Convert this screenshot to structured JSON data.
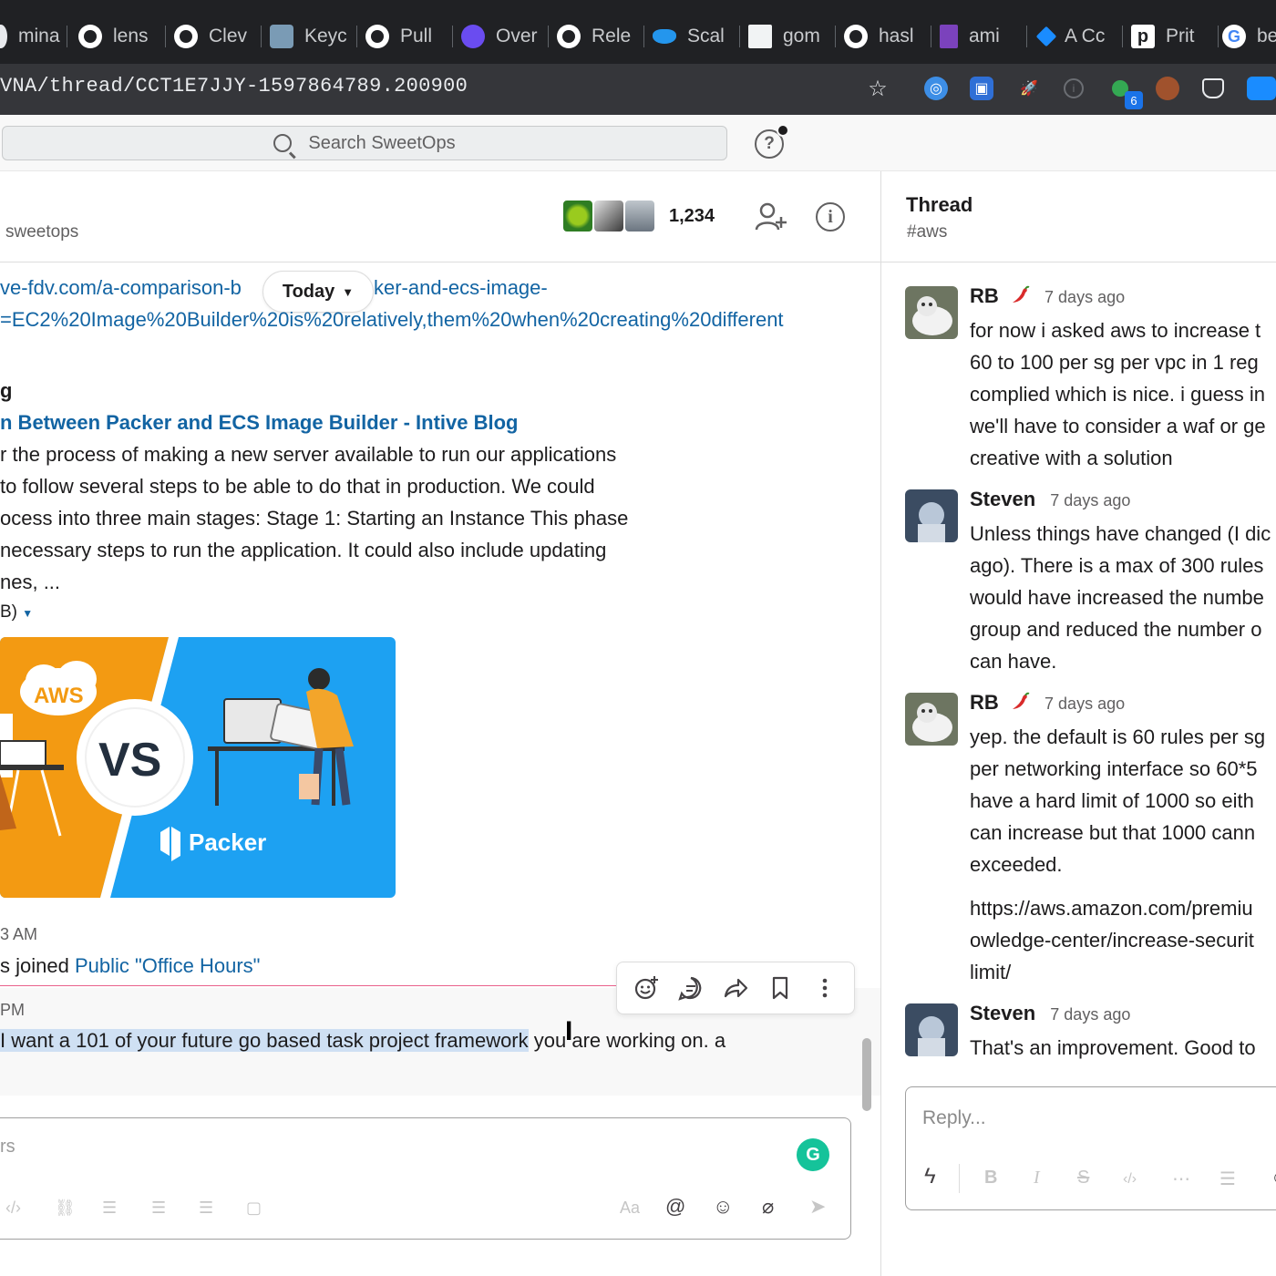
{
  "browser": {
    "tabs": [
      {
        "label": "mina",
        "icon": "generic-tab-icon"
      },
      {
        "label": "lens",
        "icon": "github-icon"
      },
      {
        "label": "Clev",
        "icon": "github-icon"
      },
      {
        "label": "Keyc",
        "icon": "keycloak-icon"
      },
      {
        "label": "Pull",
        "icon": "github-icon"
      },
      {
        "label": "Over",
        "icon": "overview-icon"
      },
      {
        "label": "Rele",
        "icon": "github-icon"
      },
      {
        "label": "Scal",
        "icon": "docker-icon"
      },
      {
        "label": "gom",
        "icon": "document-icon"
      },
      {
        "label": "hasl",
        "icon": "github-icon"
      },
      {
        "label": "ami",
        "icon": "terraform-icon"
      },
      {
        "label": "A Cc",
        "icon": "diamond-icon"
      },
      {
        "label": "Prit",
        "icon": "pritunl-icon"
      },
      {
        "label": "be",
        "icon": "google-icon"
      }
    ],
    "url": "VNA/thread/CCT1E7JJY-1597864789.200900",
    "extension_badge": "6"
  },
  "slack": {
    "search_placeholder": "Search SweetOps",
    "help_label": "?",
    "channel": {
      "workspace": "sweetops",
      "member_count": "1,234"
    },
    "messages": {
      "today_label": "Today",
      "link_line1_a": "ve-fdv.com/a-comparison-b",
      "link_line1_b": "ker-and-ecs-image-",
      "link_line2": "=EC2%20Image%20Builder%20is%20relatively,them%20when%20creating%20different",
      "unfurl_source": "g",
      "unfurl_title": "n Between Packer and ECS Image Builder - Intive Blog",
      "unfurl_desc": [
        "r the process of making a new server available to run our applications",
        "to follow several steps to be able to do that in production. We could",
        "ocess into three main stages:  Stage 1: Starting an Instance  This phase",
        " necessary steps to run the application. It could also include updating",
        "nes, ..."
      ],
      "unfurl_size": "B)",
      "image_text": {
        "aws": "AWS",
        "vs": "VS",
        "packer": "Packer"
      },
      "joined_time": "3 AM",
      "joined_prefix": "s joined ",
      "joined_channel": "Public \"Office Hours\"",
      "last_time": "PM",
      "last_selected": "I want a 101 of your future go based task project framework",
      "last_rest": " you are working on. a"
    },
    "composer": {
      "placeholder": "rs",
      "grammarly": "G",
      "aa": "Aa",
      "at": "@"
    }
  },
  "thread": {
    "title": "Thread",
    "channel": "#aws",
    "messages": [
      {
        "author": "RB",
        "emoji": "chili-pepper-icon",
        "time": "7 days ago",
        "lines": [
          "for now i asked aws to increase t",
          "60 to 100 per sg per vpc in 1 reg",
          "complied which is nice. i guess in",
          "we'll have to consider a waf or ge",
          "creative with a solution"
        ]
      },
      {
        "author": "Steven",
        "time": "7 days ago",
        "lines": [
          "Unless things have changed (I dic",
          "ago). There is a max of 300 rules",
          "would have increased the numbe",
          "group and reduced the number o",
          "can have."
        ]
      },
      {
        "author": "RB",
        "emoji": "chili-pepper-icon",
        "time": "7 days ago",
        "lines": [
          "yep. the default is 60 rules per sg",
          "per networking interface so 60*5",
          "have a hard limit of 1000 so eith",
          "can increase but that 1000 cann",
          "exceeded."
        ],
        "link_lines": [
          "https://aws.amazon.com/premiu",
          "owledge-center/increase-securit",
          "limit/"
        ]
      },
      {
        "author": "Steven",
        "time": "7 days ago",
        "lines": [
          "That's an improvement. Good to"
        ]
      }
    ],
    "reply_placeholder": "Reply..."
  }
}
